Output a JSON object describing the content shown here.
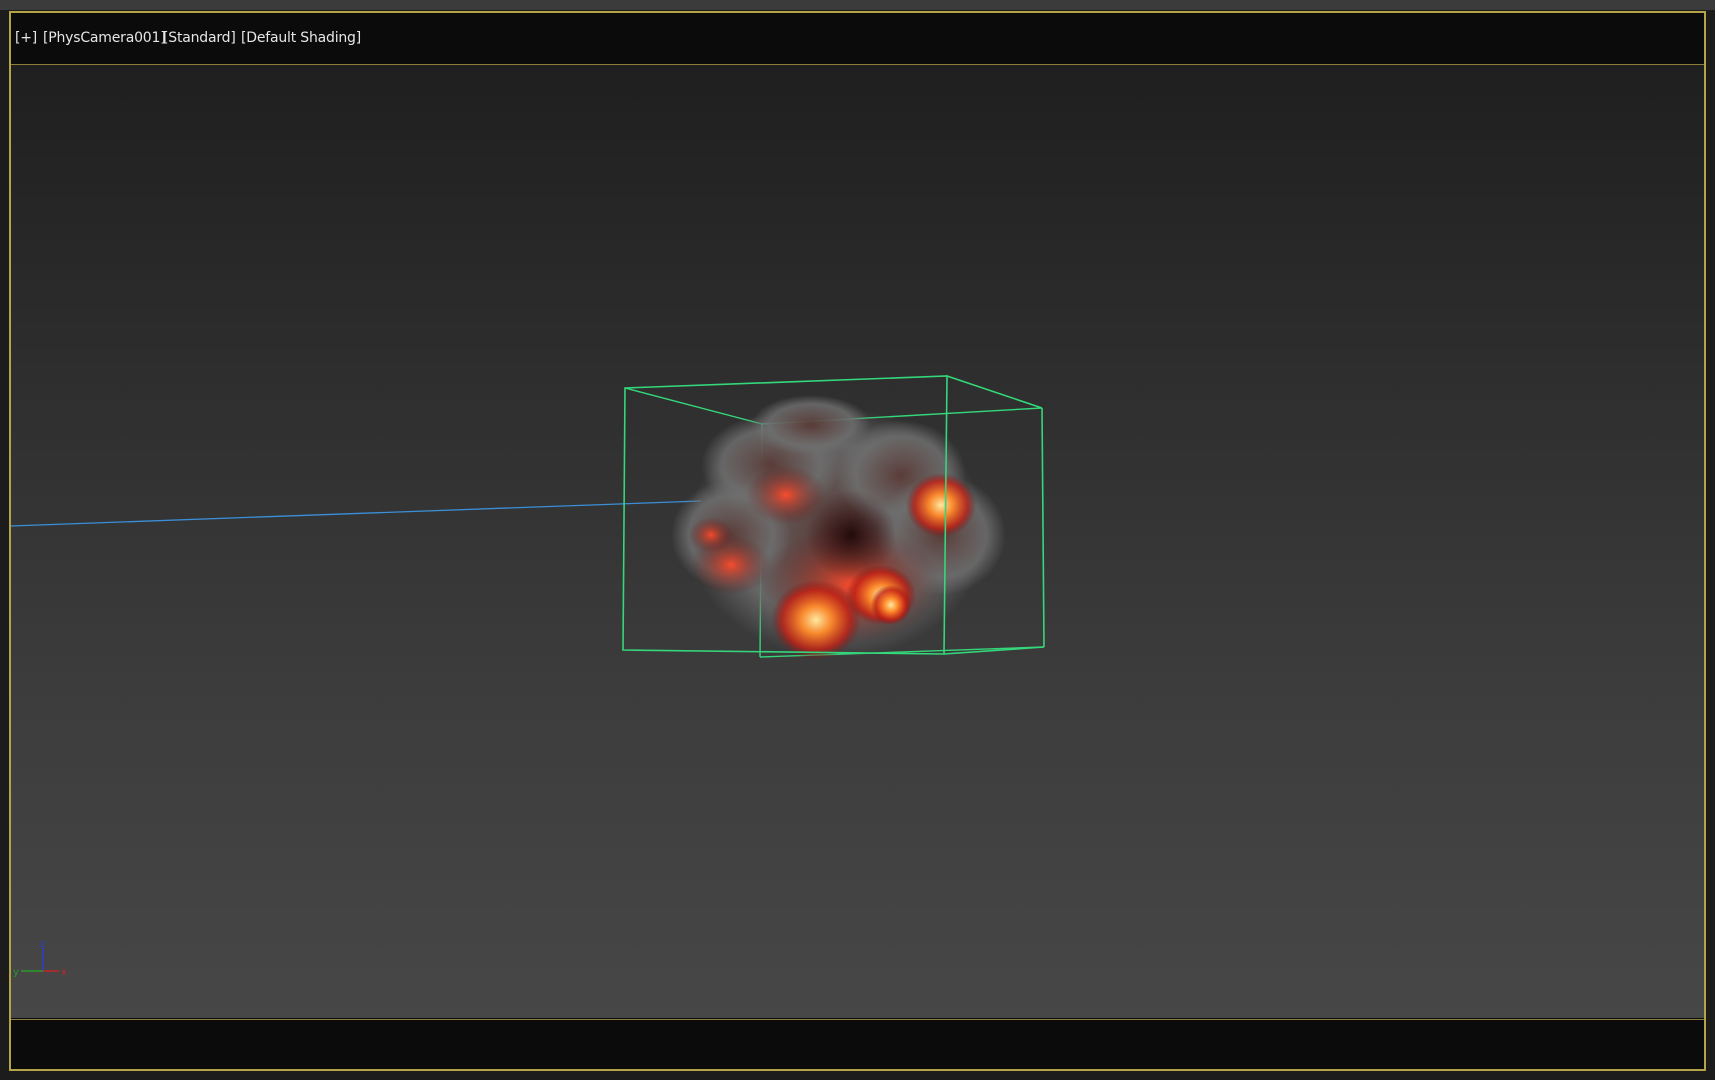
{
  "viewport": {
    "labels": {
      "menu": "[+]",
      "camera": "[PhysCamera001]",
      "render_mode": "[Standard]",
      "shading": "[Default Shading]"
    },
    "active_border_color": "#b5a447",
    "bounding_box_color": "#34d77a",
    "camera_line_color": "#3a8fd8",
    "axis_gizmo": {
      "z_label": "z",
      "y_label": "y",
      "x_label": "x",
      "x_color": "#c0282a",
      "y_color": "#2a9a2a",
      "z_color": "#2a3fd0"
    },
    "scene_object": {
      "type": "explosion-smoke-volume",
      "icon": "fire-cloud"
    }
  }
}
